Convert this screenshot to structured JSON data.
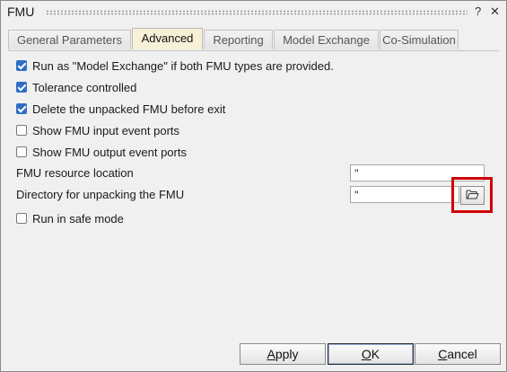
{
  "window": {
    "title": "FMU",
    "help_glyph": "?",
    "close_glyph": "✕"
  },
  "tabs": [
    {
      "label": "General Parameters"
    },
    {
      "label": "Advanced",
      "active": true
    },
    {
      "label": "Reporting"
    },
    {
      "label": "Model Exchange"
    },
    {
      "label": "Co-Simulation"
    }
  ],
  "options": [
    {
      "label": "Run as \"Model Exchange\" if both FMU types are provided.",
      "checked": true
    },
    {
      "label": "Tolerance controlled",
      "checked": true
    },
    {
      "label": "Delete the unpacked FMU before exit",
      "checked": true
    },
    {
      "label": "Show FMU input event ports",
      "checked": false
    },
    {
      "label": "Show FMU output event ports",
      "checked": false
    }
  ],
  "fields": {
    "resource_location": {
      "label": "FMU resource location",
      "value": "''"
    },
    "unpack_directory": {
      "label": "Directory for unpacking the FMU",
      "value": "''",
      "browse_icon": "folder-open-icon"
    }
  },
  "safe_mode": {
    "label": "Run in safe mode",
    "checked": false
  },
  "buttons": {
    "apply": {
      "pre": "",
      "accel": "A",
      "post": "pply"
    },
    "ok": {
      "pre": "",
      "accel": "O",
      "post": "K"
    },
    "cancel": {
      "pre": "",
      "accel": "C",
      "post": "ancel"
    }
  },
  "colors": {
    "active_tab": "#f7f1d8",
    "checkbox_checked": "#2f6ec4",
    "highlight": "#d10000"
  }
}
